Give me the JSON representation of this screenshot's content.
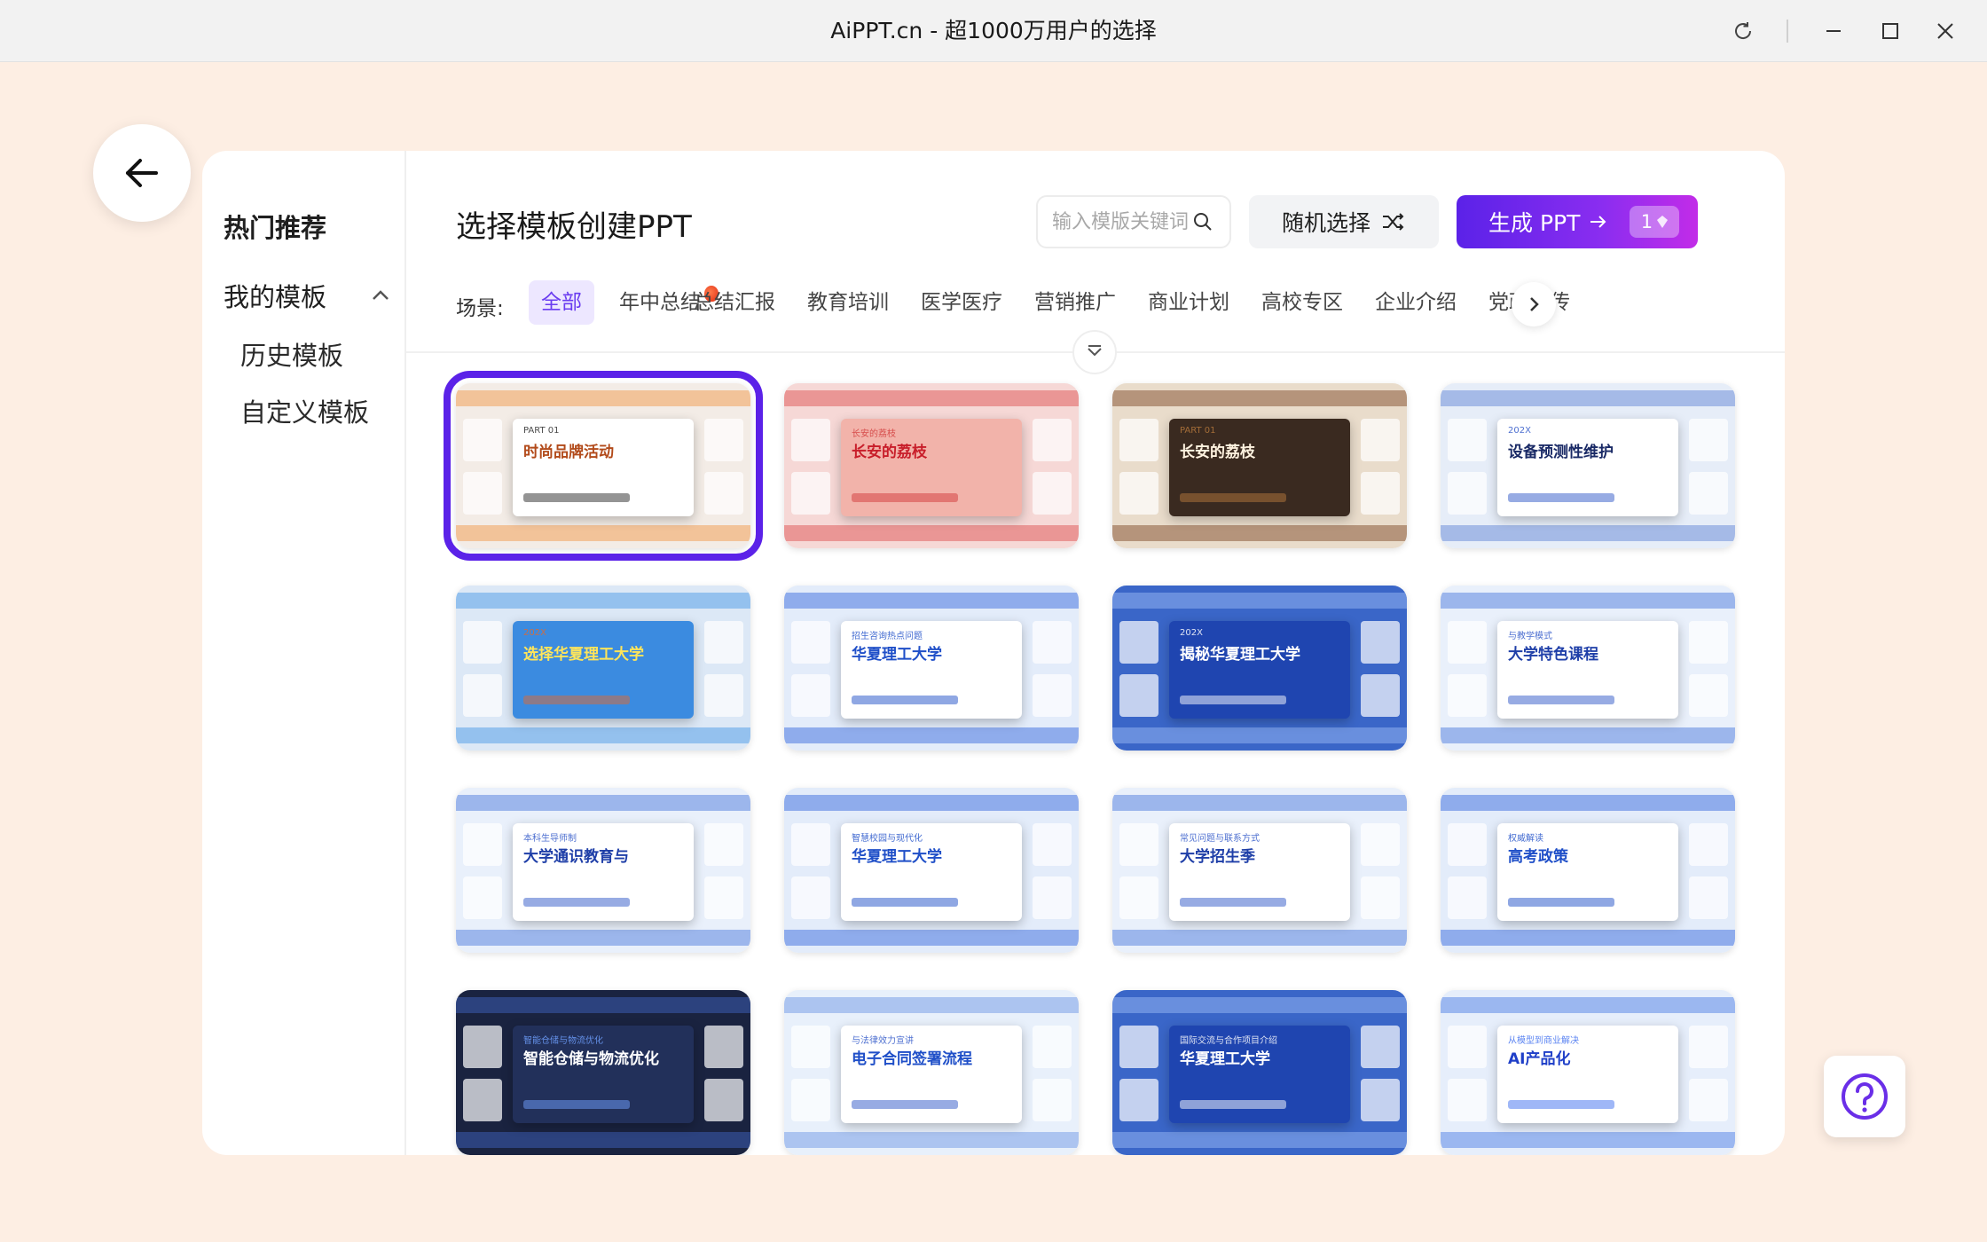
{
  "window": {
    "title": "AiPPT.cn - 超1000万用户的选择"
  },
  "sidebar": {
    "hot": "热门推荐",
    "my_templates": "我的模板",
    "sub_items": [
      {
        "label": "历史模板"
      },
      {
        "label": "自定义模板"
      }
    ]
  },
  "header": {
    "title": "选择模板创建PPT",
    "search_placeholder": "输入模版关键词",
    "random_label": "随机选择",
    "generate_label": "生成 PPT",
    "generate_count": "1"
  },
  "categories": {
    "label": "场景:",
    "items": [
      {
        "label": "全部",
        "active": true
      },
      {
        "label": "年中总结",
        "hot": true
      },
      {
        "label": "总结汇报"
      },
      {
        "label": "教育培训"
      },
      {
        "label": "医学医疗"
      },
      {
        "label": "营销推广"
      },
      {
        "label": "商业计划"
      },
      {
        "label": "高校专区"
      },
      {
        "label": "企业介绍"
      },
      {
        "label": "党政宣传"
      }
    ]
  },
  "templates": [
    {
      "title": "时尚品牌活动",
      "sub": "PART 01",
      "theme": "fashion",
      "selected": true
    },
    {
      "title": "长安的荔枝",
      "sub": "长安的荔枝",
      "theme": "red"
    },
    {
      "title": "长安的荔枝",
      "sub": "PART 01",
      "theme": "brown"
    },
    {
      "title": "设备预测性维护",
      "sub": "202X",
      "theme": "techblue"
    },
    {
      "title": "选择华夏理工大学",
      "sub": "202X",
      "theme": "campus"
    },
    {
      "title": "华夏理工大学",
      "sub": "招生咨询热点问题",
      "theme": "blue"
    },
    {
      "title": "揭秘华夏理工大学",
      "sub": "202X",
      "theme": "darkblue"
    },
    {
      "title": "大学特色课程",
      "sub": "与教学模式",
      "theme": "lightblue"
    },
    {
      "title": "大学通识教育与",
      "sub": "本科生导师制",
      "theme": "lightblue"
    },
    {
      "title": "华夏理工大学",
      "sub": "智慧校园与现代化",
      "theme": "blue"
    },
    {
      "title": "大学招生季",
      "sub": "常见问题与联系方式",
      "theme": "lightblue"
    },
    {
      "title": "高考政策",
      "sub": "权威解读",
      "theme": "blue"
    },
    {
      "title": "智能仓储与物流优化",
      "sub": "智能仓储与物流优化",
      "theme": "navy"
    },
    {
      "title": "电子合同签署流程",
      "sub": "与法律效力宣讲",
      "theme": "city"
    },
    {
      "title": "华夏理工大学",
      "sub": "国际交流与合作项目介绍",
      "theme": "darkblue"
    },
    {
      "title": "AI产品化",
      "sub": "从模型到商业解决",
      "theme": "ai"
    }
  ],
  "colors": {
    "accent": "#5b22e8",
    "gradient_end": "#c22ce8",
    "page_bg": "#fdeee3"
  }
}
